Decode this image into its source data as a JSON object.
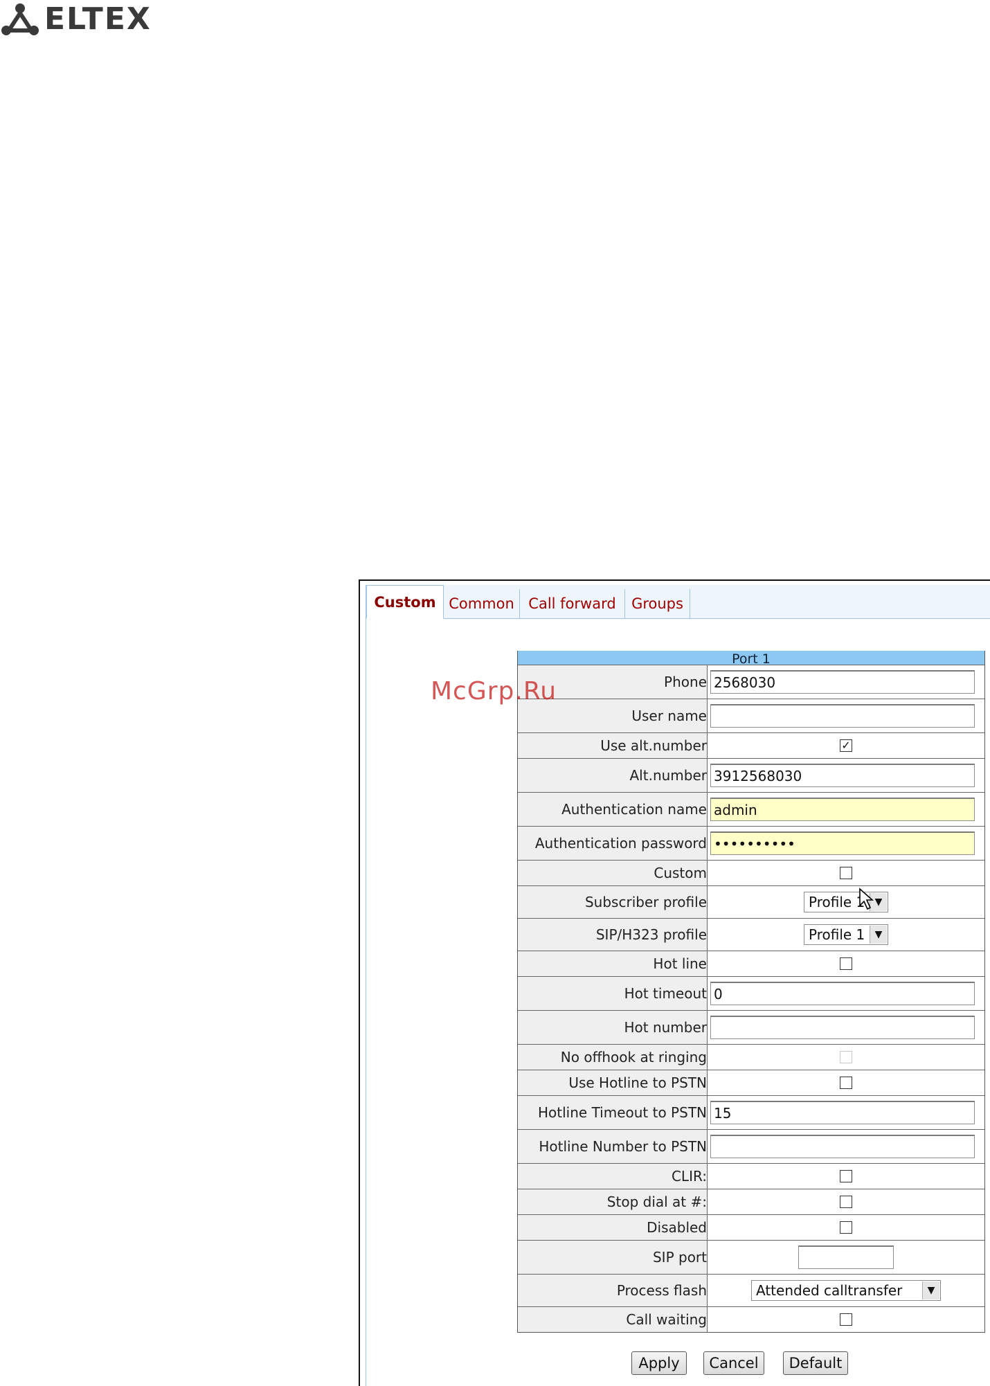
{
  "logo": {
    "text": "ELTEX",
    "icon": "eltex-people-icon"
  },
  "tabs": [
    {
      "label": "Custom",
      "active": true
    },
    {
      "label": "Common",
      "active": false
    },
    {
      "label": "Call forward",
      "active": false
    },
    {
      "label": "Groups",
      "active": false
    }
  ],
  "watermark": "McGrp.Ru",
  "port": {
    "title": "Port 1",
    "phone": {
      "label": "Phone",
      "value": "2568030"
    },
    "user_name": {
      "label": "User name",
      "value": ""
    },
    "use_alt_number": {
      "label": "Use alt.number",
      "checked": true
    },
    "alt_number": {
      "label": "Alt.number",
      "value": "3912568030"
    },
    "auth_name": {
      "label": "Authentication name",
      "value": "admin"
    },
    "auth_password": {
      "label": "Authentication password",
      "value": "••••••••••"
    },
    "custom": {
      "label": "Custom",
      "checked": false
    },
    "subscriber_profile": {
      "label": "Subscriber profile",
      "value": "Profile 1"
    },
    "sip_h323_profile": {
      "label": "SIP/H323 profile",
      "value": "Profile 1"
    },
    "hot_line": {
      "label": "Hot line",
      "checked": false
    },
    "hot_timeout": {
      "label": "Hot timeout",
      "value": "0"
    },
    "hot_number": {
      "label": "Hot number",
      "value": ""
    },
    "no_offhook": {
      "label": "No offhook at ringing",
      "checked": false,
      "disabled": true
    },
    "use_hotline_pstn": {
      "label": "Use Hotline to PSTN",
      "checked": false
    },
    "hotline_timeout_pstn": {
      "label": "Hotline Timeout to PSTN",
      "value": "15"
    },
    "hotline_number_pstn": {
      "label": "Hotline Number to PSTN",
      "value": ""
    },
    "clir": {
      "label": "CLIR:",
      "checked": false
    },
    "stop_dial": {
      "label": "Stop dial at #:",
      "checked": false
    },
    "disabled": {
      "label": "Disabled",
      "checked": false
    },
    "sip_port": {
      "label": "SIP port",
      "value": ""
    },
    "process_flash": {
      "label": "Process flash",
      "value": "Attended calltransfer"
    },
    "call_waiting": {
      "label": "Call waiting",
      "checked": false
    }
  },
  "buttons": {
    "apply": "Apply",
    "cancel": "Cancel",
    "default": "Default"
  },
  "colors": {
    "tab_text": "#a00000",
    "header_bg": "#8cc8f2",
    "highlight_input": "#ffffc8"
  }
}
